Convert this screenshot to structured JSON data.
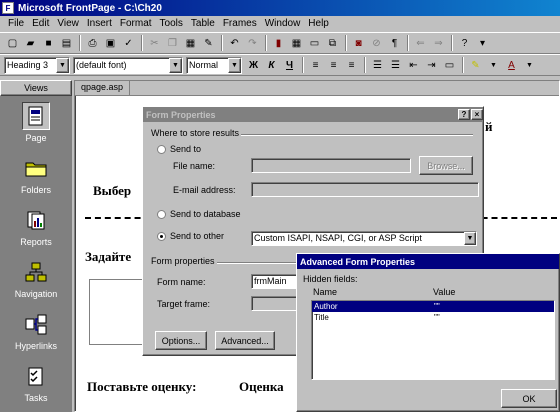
{
  "window": {
    "title": "Microsoft FrontPage - C:\\Ch20"
  },
  "menu": [
    {
      "label": "File",
      "key": "F"
    },
    {
      "label": "Edit",
      "key": "E"
    },
    {
      "label": "View",
      "key": "V"
    },
    {
      "label": "Insert",
      "key": "I"
    },
    {
      "label": "Format",
      "key": "o"
    },
    {
      "label": "Tools",
      "key": "T"
    },
    {
      "label": "Table",
      "key": "a"
    },
    {
      "label": "Frames",
      "key": "r"
    },
    {
      "label": "Window",
      "key": "W"
    },
    {
      "label": "Help",
      "key": "H"
    }
  ],
  "toolbar_format": {
    "style": "Heading 3",
    "font": "(default font)",
    "size": "Normal",
    "bold": "Ж",
    "italic": "К",
    "underline": "Ч"
  },
  "views": {
    "header": "Views",
    "items": [
      {
        "label": "Page",
        "icon": "page-icon"
      },
      {
        "label": "Folders",
        "icon": "folders-icon"
      },
      {
        "label": "Reports",
        "icon": "reports-icon"
      },
      {
        "label": "Navigation",
        "icon": "navigation-icon"
      },
      {
        "label": "Hyperlinks",
        "icon": "hyperlinks-icon"
      },
      {
        "label": "Tasks",
        "icon": "tasks-icon"
      }
    ]
  },
  "editor": {
    "tab": "qpage.asp",
    "text_choose": "Выбер",
    "text_set": "Задайте",
    "text_rate": "Поставьте оценку:",
    "text_score": "Оценка",
    "text_corner": "й"
  },
  "form_properties": {
    "title": "Form Properties",
    "help_btn": "?",
    "close_btn": "×",
    "group_store": "Where to store results",
    "opt_file": "Send to",
    "label_file": "File name:",
    "file_value": "",
    "browse": "Browse...",
    "label_email": "E-mail address:",
    "email_value": "",
    "opt_db": "Send to database",
    "opt_other": "Send to other",
    "other_value": "Custom ISAPI, NSAPI, CGI, or ASP Script",
    "group_props": "Form properties",
    "label_name": "Form name:",
    "name_value": "frmMain",
    "label_target": "Target frame:",
    "target_value": "",
    "options_btn": "Options...",
    "advanced_btn": "Advanced..."
  },
  "advanced": {
    "title": "Advanced Form Properties",
    "group_hidden": "Hidden fields:",
    "col_name": "Name",
    "col_value": "Value",
    "rows": [
      {
        "name": "Author",
        "value": "\"\""
      },
      {
        "name": "Title",
        "value": "\"\""
      }
    ],
    "ok": "OK"
  }
}
